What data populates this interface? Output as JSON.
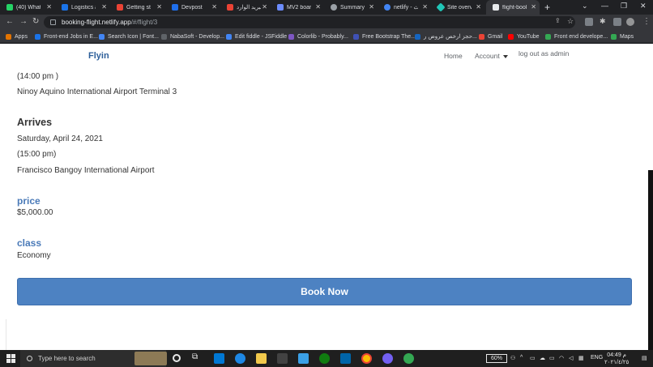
{
  "browser": {
    "tabs": [
      {
        "label": "(40) Whats",
        "color": "#25d366"
      },
      {
        "label": "Logistics an",
        "color": "#1a73e8"
      },
      {
        "label": "Getting sta",
        "color": "#ea4335"
      },
      {
        "label": "Devpost",
        "color": "#1f6feb"
      },
      {
        "label": "البريد الوارد",
        "color": "#ea4335"
      },
      {
        "label": "MV2 board",
        "color": "#6c8cff"
      },
      {
        "label": "Summary",
        "color": "#9aa0a6"
      },
      {
        "label": "netlify - بحث",
        "color": "#4285f4"
      },
      {
        "label": "Site overvie",
        "color": "#20c6b7"
      },
      {
        "label": "flight-book",
        "color": "#e8eaed"
      }
    ],
    "url_host": "booking-flight.netlify.app",
    "url_path": "/#/flight/3",
    "bookmarks": [
      {
        "label": "Apps",
        "color": "#e37400"
      },
      {
        "label": "Front-end Jobs in E...",
        "color": "#1a73e8"
      },
      {
        "label": "Search Icon | Font...",
        "color": "#4285f4"
      },
      {
        "label": "NabaSoft - Develop...",
        "color": "#5f6368"
      },
      {
        "label": "Edit fiddle - JSFiddle",
        "color": "#4285f4"
      },
      {
        "label": "Colorlib - Probably...",
        "color": "#7e57c2"
      },
      {
        "label": "Free Bootstrap The...",
        "color": "#3f51b5"
      },
      {
        "label": "حجز ارخص عروض ر...",
        "color": "#1565c0"
      },
      {
        "label": "Gmail",
        "color": "#ea4335"
      },
      {
        "label": "YouTube",
        "color": "#ff0000"
      },
      {
        "label": "Front end develope...",
        "color": "#34a853"
      },
      {
        "label": "Maps",
        "color": "#34a853"
      }
    ]
  },
  "site": {
    "brand": "Flyin",
    "nav": {
      "home": "Home",
      "account": "Account",
      "logout": "log out as admin"
    }
  },
  "flight": {
    "departure_time": "(14:00 pm )",
    "departure_airport": "Ninoy Aquino International Airport Terminal 3",
    "arrives_heading": "Arrives",
    "arrival_date": "Saturday, April 24, 2021",
    "arrival_time": "(15:00 pm)",
    "arrival_airport": "Francisco Bangoy International Airport",
    "price_label": "price",
    "price_value": "$5,000.00",
    "class_label": "class",
    "class_value": "Economy",
    "book_button": "Book Now"
  },
  "taskbar": {
    "search_placeholder": "Type here to search",
    "battery": "60%",
    "language": "ENG",
    "time": "04:49 م",
    "date": "٢٠٢١/٤/٢٥"
  },
  "colors": {
    "accent_blue": "#4d82c2",
    "label_blue": "#4a7ab8",
    "brand_blue": "#2d5f9a"
  }
}
